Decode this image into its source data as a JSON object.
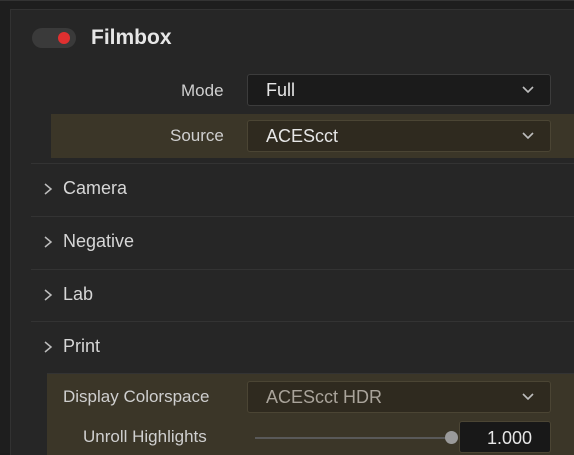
{
  "header": {
    "title": "Filmbox",
    "toggle_on": true
  },
  "mode": {
    "label": "Mode",
    "value": "Full"
  },
  "source": {
    "label": "Source",
    "value": "ACEScct"
  },
  "sections": [
    {
      "label": "Camera"
    },
    {
      "label": "Negative"
    },
    {
      "label": "Lab"
    },
    {
      "label": "Print"
    }
  ],
  "display": {
    "label": "Display Colorspace",
    "value": "ACEScct HDR"
  },
  "unroll": {
    "label": "Unroll Highlights",
    "value": "1.000",
    "level": 1.0
  },
  "colors": {
    "highlight": "#3b3628",
    "toggle_dot": "#e03030"
  },
  "icons": {
    "dropdown": "chevron-down-icon",
    "section": "chevron-right-icon"
  }
}
